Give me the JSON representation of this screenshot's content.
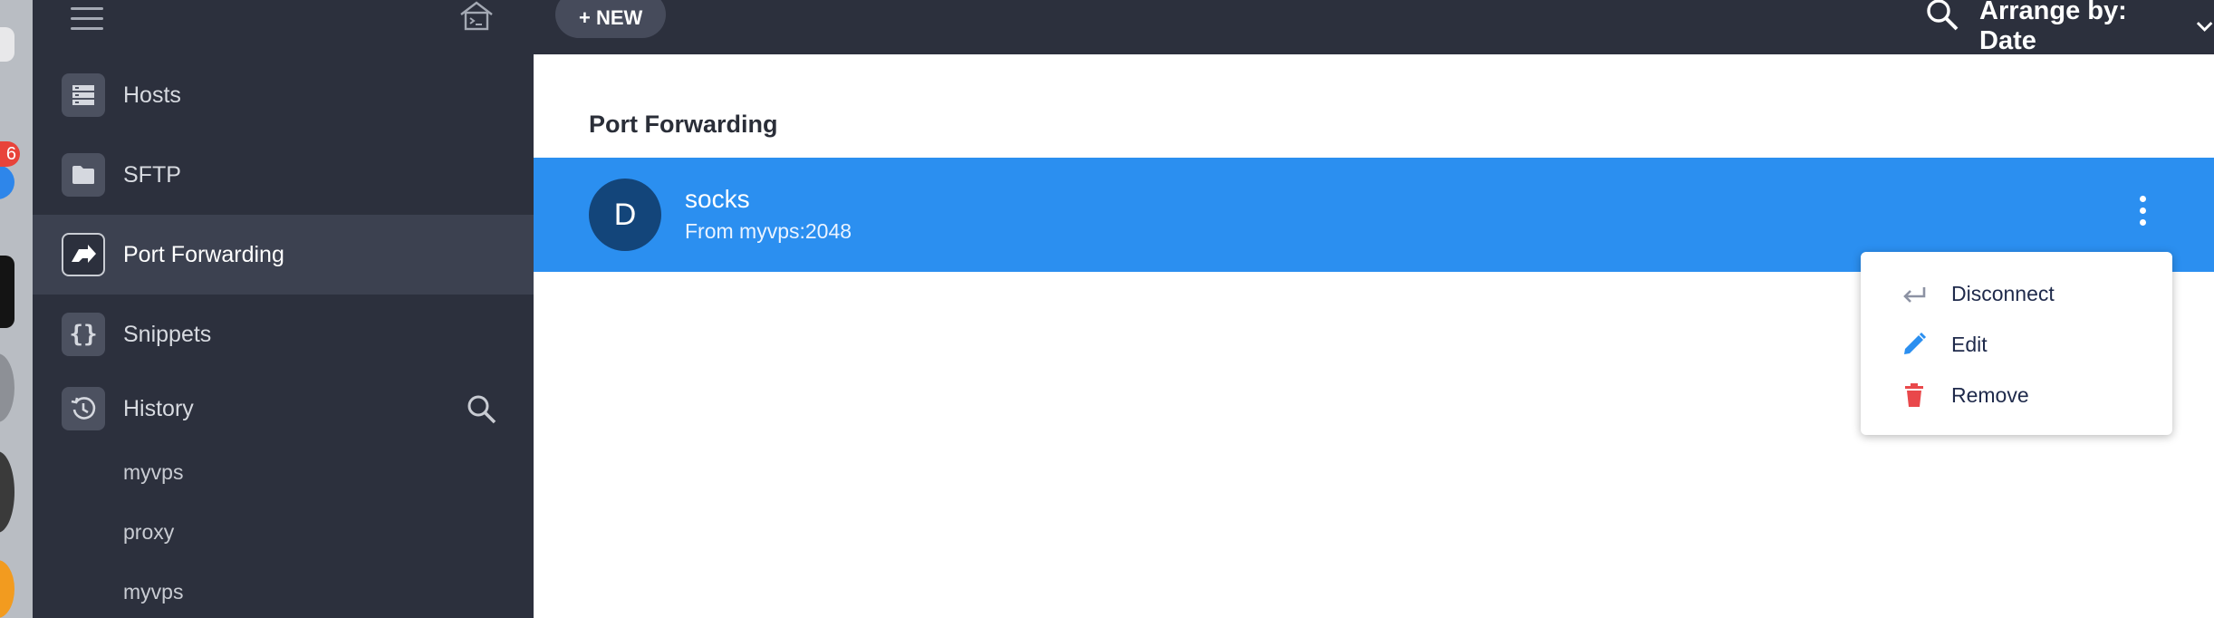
{
  "header": {
    "new_button": "+ NEW",
    "arrange_label": "Arrange by: Date"
  },
  "sidebar": {
    "items": [
      {
        "label": "Hosts",
        "icon": "hosts-icon"
      },
      {
        "label": "SFTP",
        "icon": "folder-icon"
      },
      {
        "label": "Port Forwarding",
        "icon": "port-forwarding-icon",
        "active": true
      },
      {
        "label": "Snippets",
        "icon": "snippets-icon"
      },
      {
        "label": "History",
        "icon": "history-icon"
      }
    ],
    "history": [
      "myvps",
      "proxy",
      "myvps"
    ],
    "dock_badge": "6"
  },
  "main": {
    "section_title": "Port Forwarding",
    "rule": {
      "avatar_letter": "D",
      "name": "socks",
      "subtitle": "From myvps:2048"
    }
  },
  "context_menu": {
    "items": [
      {
        "label": "Disconnect",
        "icon": "disconnect-icon"
      },
      {
        "label": "Edit",
        "icon": "pencil-icon"
      },
      {
        "label": "Remove",
        "icon": "trash-icon"
      }
    ]
  },
  "colors": {
    "sidebar_bg": "#2c303d",
    "sidebar_active": "#3c4150",
    "selection_blue": "#2b8ff0",
    "avatar_bg": "#13457a",
    "edit_blue": "#2b8ff0",
    "remove_red": "#e9484b"
  }
}
